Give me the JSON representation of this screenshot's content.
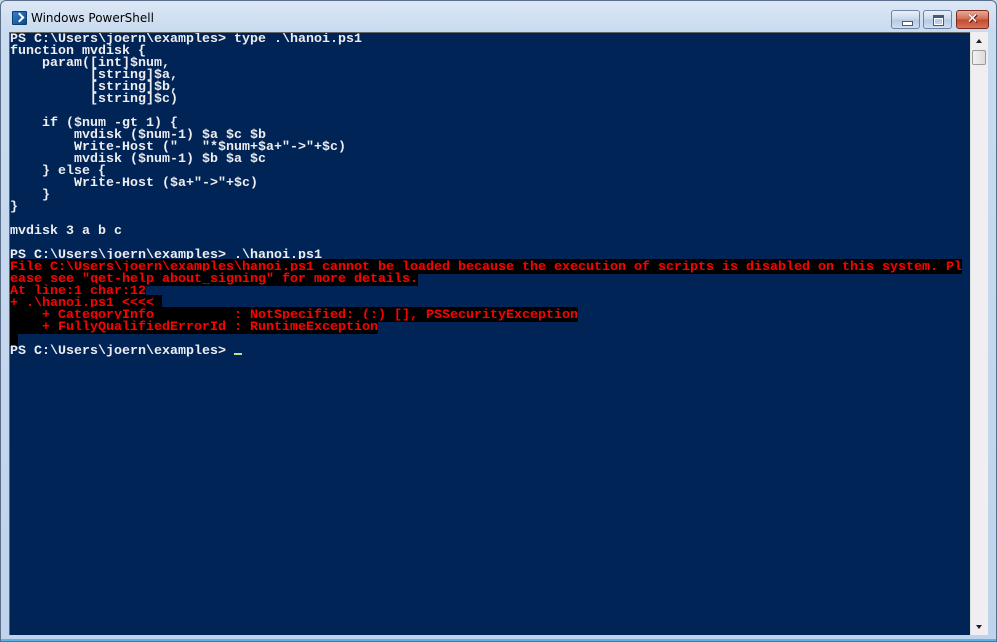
{
  "window": {
    "title": "Windows PowerShell",
    "icon": "powershell-icon",
    "controls": {
      "minimize": "minimize-icon",
      "maximize": "maximize-icon",
      "close_glyph": "✕"
    }
  },
  "colors": {
    "console_background": "#012456",
    "console_foreground": "#eeedf0",
    "error_foreground": "#ff0000",
    "error_background": "#000000",
    "cursor": "#bfe28d"
  },
  "console": {
    "lines": [
      {
        "type": "normal",
        "text": "PS C:\\Users\\joern\\examples> type .\\hanoi.ps1"
      },
      {
        "type": "normal",
        "text": "function mvdisk {"
      },
      {
        "type": "normal",
        "text": "    param([int]$num,"
      },
      {
        "type": "normal",
        "text": "          [string]$a,"
      },
      {
        "type": "normal",
        "text": "          [string]$b,"
      },
      {
        "type": "normal",
        "text": "          [string]$c)"
      },
      {
        "type": "normal",
        "text": ""
      },
      {
        "type": "normal",
        "text": "    if ($num -gt 1) {"
      },
      {
        "type": "normal",
        "text": "        mvdisk ($num-1) $a $c $b"
      },
      {
        "type": "normal",
        "text": "        Write-Host (\"   \"*$num+$a+\"->\"+$c)"
      },
      {
        "type": "normal",
        "text": "        mvdisk ($num-1) $b $a $c"
      },
      {
        "type": "normal",
        "text": "    } else {"
      },
      {
        "type": "normal",
        "text": "        Write-Host ($a+\"->\"+$c)"
      },
      {
        "type": "normal",
        "text": "    }"
      },
      {
        "type": "normal",
        "text": "}"
      },
      {
        "type": "normal",
        "text": ""
      },
      {
        "type": "normal",
        "text": "mvdisk 3 a b c"
      },
      {
        "type": "normal",
        "text": ""
      },
      {
        "type": "normal",
        "text": "PS C:\\Users\\joern\\examples> .\\hanoi.ps1"
      },
      {
        "type": "error",
        "text": "File C:\\Users\\joern\\examples\\hanoi.ps1 cannot be loaded because the execution of scripts is disabled on this system. Pl"
      },
      {
        "type": "error",
        "text": "ease see \"get-help about_signing\" for more details."
      },
      {
        "type": "error",
        "text": "At line:1 char:12"
      },
      {
        "type": "error",
        "text": "+ .\\hanoi.ps1 <<<< "
      },
      {
        "type": "error",
        "text": "    + CategoryInfo          : NotSpecified: (:) [], PSSecurityException"
      },
      {
        "type": "error",
        "text": "    + FullyQualifiedErrorId : RuntimeException"
      },
      {
        "type": "error",
        "text": " "
      },
      {
        "type": "normal",
        "text": "PS C:\\Users\\joern\\examples> ",
        "cursor": true
      }
    ]
  },
  "scrollbar": {
    "up_icon": "scroll-up-arrow-icon",
    "down_icon": "scroll-down-arrow-icon",
    "position_fraction": 0.0
  }
}
